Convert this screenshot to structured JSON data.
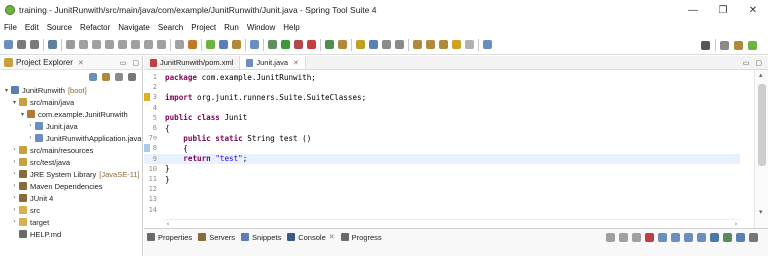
{
  "window": {
    "title": "training - JunitRunwith/src/main/java/com/example/JunitRunwith/Junit.java - Spring Tool Suite 4",
    "controls": [
      {
        "name": "minimize-button",
        "glyph": "—"
      },
      {
        "name": "maximize-button",
        "glyph": "❐"
      },
      {
        "name": "close-button",
        "glyph": "✕"
      }
    ]
  },
  "menu": [
    "File",
    "Edit",
    "Source",
    "Refactor",
    "Navigate",
    "Search",
    "Project",
    "Run",
    "Window",
    "Help"
  ],
  "toolbar": {
    "icons": [
      {
        "name": "new-icon",
        "color": "#6a8fbf"
      },
      {
        "name": "save-icon",
        "color": "#7a7a7a"
      },
      {
        "name": "save-all-icon",
        "color": "#7a7a7a"
      },
      {
        "name": "sep"
      },
      {
        "name": "console-icon",
        "color": "#5f7f9f"
      },
      {
        "name": "sep"
      },
      {
        "name": "skip-breakpoints-icon",
        "color": "#9a9a9a"
      },
      {
        "name": "resume-icon",
        "color": "#a0a0a0"
      },
      {
        "name": "suspend-icon",
        "color": "#a0a0a0"
      },
      {
        "name": "terminate-icon",
        "color": "#a0a0a0"
      },
      {
        "name": "disconnect-icon",
        "color": "#a0a0a0"
      },
      {
        "name": "step-into-icon",
        "color": "#a0a0a0"
      },
      {
        "name": "step-over-icon",
        "color": "#a0a0a0"
      },
      {
        "name": "step-return-icon",
        "color": "#a0a0a0"
      },
      {
        "name": "sep"
      },
      {
        "name": "use-step-filters-icon",
        "color": "#a0a0a0"
      },
      {
        "name": "boot-dashboard-icon",
        "color": "#c07a2a"
      },
      {
        "name": "sep"
      },
      {
        "name": "spring-starter-icon",
        "color": "#6db33f"
      },
      {
        "name": "new-java-project-icon",
        "color": "#5a7fb0"
      },
      {
        "name": "new-package-icon",
        "color": "#b08a3a"
      },
      {
        "name": "sep"
      },
      {
        "name": "open-type-icon",
        "color": "#6a8fbf"
      },
      {
        "name": "sep"
      },
      {
        "name": "debug-icon",
        "color": "#5f8f5f"
      },
      {
        "name": "run-icon",
        "color": "#3a9a3a"
      },
      {
        "name": "coverage-icon",
        "color": "#b04a4a"
      },
      {
        "name": "external-tools-icon",
        "color": "#c04040"
      },
      {
        "name": "sep"
      },
      {
        "name": "new-class-icon",
        "color": "#4f8f4f"
      },
      {
        "name": "pencil-icon",
        "color": "#b08a3a"
      },
      {
        "name": "sep"
      },
      {
        "name": "toggle-mark-occurrences-icon",
        "color": "#c0a020"
      },
      {
        "name": "pin-icon",
        "color": "#5a7fb0"
      },
      {
        "name": "show-whitespace-icon",
        "color": "#8a8a8a"
      },
      {
        "name": "block-selection-icon",
        "color": "#8a8a8a"
      },
      {
        "name": "sep"
      },
      {
        "name": "next-annotation-icon",
        "color": "#b08a3a"
      },
      {
        "name": "previous-annotation-icon",
        "color": "#b08a3a"
      },
      {
        "name": "last-edit-icon",
        "color": "#b08a3a"
      },
      {
        "name": "back-icon",
        "color": "#d0a020"
      },
      {
        "name": "forward-icon",
        "color": "#b0b0b0"
      },
      {
        "name": "sep"
      },
      {
        "name": "open-perspective-icon",
        "color": "#6a8fbf"
      }
    ],
    "right_icons": [
      {
        "name": "search-icon",
        "color": "#555555"
      },
      {
        "name": "sep"
      },
      {
        "name": "java-ee-perspective-icon",
        "color": "#8a8a8a"
      },
      {
        "name": "java-perspective-icon",
        "color": "#b08a3a"
      },
      {
        "name": "spring-perspective-icon",
        "color": "#6db33f"
      }
    ]
  },
  "explorer": {
    "title": "Project Explorer",
    "tools": [
      {
        "name": "collapse-all-icon",
        "color": "#6a8fbf"
      },
      {
        "name": "link-with-editor-icon",
        "color": "#b08a3a"
      },
      {
        "name": "filter-icon",
        "color": "#8a8a8a"
      },
      {
        "name": "view-menu-icon",
        "color": "#777777"
      }
    ],
    "tree": [
      {
        "indent": 0,
        "arrow": "▾",
        "icon": "project-icon",
        "color": "#5a7fb0",
        "label": "JunitRunwith",
        "deco": "[boot]"
      },
      {
        "indent": 1,
        "arrow": "▾",
        "icon": "source-folder-icon",
        "color": "#c8a040",
        "label": "src/main/java",
        "deco": ""
      },
      {
        "indent": 2,
        "arrow": "▾",
        "icon": "package-icon",
        "color": "#b07a30",
        "label": "com.example.JunitRunwith",
        "deco": ""
      },
      {
        "indent": 3,
        "arrow": "›",
        "icon": "java-file-icon",
        "color": "#6a8fbf",
        "label": "Junit.java",
        "deco": ""
      },
      {
        "indent": 3,
        "arrow": "›",
        "icon": "java-file-icon",
        "color": "#6a8fbf",
        "label": "JunitRunwithApplication.java",
        "deco": ""
      },
      {
        "indent": 1,
        "arrow": "›",
        "icon": "source-folder-icon",
        "color": "#c8a040",
        "label": "src/main/resources",
        "deco": ""
      },
      {
        "indent": 1,
        "arrow": "›",
        "icon": "source-folder-icon",
        "color": "#c8a040",
        "label": "src/test/java",
        "deco": ""
      },
      {
        "indent": 1,
        "arrow": "›",
        "icon": "library-icon",
        "color": "#8a6a3a",
        "label": "JRE System Library",
        "deco": "[JavaSE-11]"
      },
      {
        "indent": 1,
        "arrow": "›",
        "icon": "library-icon",
        "color": "#8a6a3a",
        "label": "Maven Dependencies",
        "deco": ""
      },
      {
        "indent": 1,
        "arrow": "›",
        "icon": "library-icon",
        "color": "#8a6a3a",
        "label": "JUnit 4",
        "deco": ""
      },
      {
        "indent": 1,
        "arrow": "›",
        "icon": "folder-icon",
        "color": "#d8b050",
        "label": "src",
        "deco": ""
      },
      {
        "indent": 1,
        "arrow": "›",
        "icon": "folder-icon",
        "color": "#d8b050",
        "label": "target",
        "deco": ""
      },
      {
        "indent": 1,
        "arrow": "",
        "icon": "markdown-file-icon",
        "color": "#6a6a6a",
        "label": "HELP.md",
        "deco": ""
      }
    ]
  },
  "editor": {
    "tabs": [
      {
        "label": "JunitRunwith/pom.xml",
        "color": "#c04040",
        "active": false
      },
      {
        "label": "Junit.java",
        "color": "#6a8fbf",
        "active": true
      }
    ],
    "lines": [
      {
        "n": "1",
        "tokens": [
          [
            "kw",
            "package"
          ],
          [
            "",
            " com.example.JunitRunwith;"
          ]
        ]
      },
      {
        "n": "2",
        "tokens": []
      },
      {
        "n": "3",
        "tokens": [
          [
            "kw",
            "import"
          ],
          [
            "",
            " org.junit.runners.Suite.SuiteClasses;"
          ]
        ],
        "marker": "#e0b020"
      },
      {
        "n": "4",
        "tokens": []
      },
      {
        "n": "5",
        "tokens": [
          [
            "kw",
            "public class"
          ],
          [
            "",
            " Junit"
          ]
        ]
      },
      {
        "n": "6",
        "tokens": [
          [
            "",
            "{"
          ]
        ]
      },
      {
        "n": "7⊖",
        "tokens": [
          [
            "",
            "    "
          ],
          [
            "kw",
            "public static"
          ],
          [
            "",
            " String test ()"
          ]
        ]
      },
      {
        "n": "8",
        "tokens": [
          [
            "",
            "    {"
          ]
        ],
        "marker": "#aac8ea"
      },
      {
        "n": "9",
        "tokens": [
          [
            "",
            "    "
          ],
          [
            "kw",
            "return"
          ],
          [
            "",
            " "
          ],
          [
            "str",
            "\"test\""
          ],
          [
            "",
            ";"
          ]
        ],
        "highlight": true
      },
      {
        "n": "10",
        "tokens": [
          [
            "",
            "}"
          ]
        ]
      },
      {
        "n": "11",
        "tokens": [
          [
            "",
            "}"
          ]
        ]
      },
      {
        "n": "12",
        "tokens": []
      },
      {
        "n": "13",
        "tokens": []
      },
      {
        "n": "14",
        "tokens": []
      }
    ]
  },
  "bottom": {
    "tabs": [
      {
        "label": "Properties",
        "icon": "properties-icon",
        "color": "#6a6a6a",
        "close": false
      },
      {
        "label": "Servers",
        "icon": "servers-icon",
        "color": "#8a6a3a",
        "close": false
      },
      {
        "label": "Snippets",
        "icon": "snippets-icon",
        "color": "#5a7fb0",
        "close": false
      },
      {
        "label": "Console",
        "icon": "console-icon",
        "color": "#3a5a8a",
        "close": true
      },
      {
        "label": "Progress",
        "icon": "progress-icon",
        "color": "#6a6a6a",
        "close": false
      }
    ],
    "tools": [
      {
        "name": "clear-console-icon",
        "color": "#a0a0a0"
      },
      {
        "name": "remove-launch-icon",
        "color": "#a0a0a0"
      },
      {
        "name": "remove-all-icon",
        "color": "#a0a0a0"
      },
      {
        "name": "terminate-icon",
        "color": "#c04040"
      },
      {
        "name": "scroll-lock-icon",
        "color": "#6a8fbf"
      },
      {
        "name": "word-wrap-icon",
        "color": "#6a8fbf"
      },
      {
        "name": "show-on-output-icon",
        "color": "#6a8fbf"
      },
      {
        "name": "pin-console-icon",
        "color": "#6a8fbf"
      },
      {
        "name": "display-console-icon",
        "color": "#4a7aa0"
      },
      {
        "name": "open-console-icon",
        "color": "#5a8a5a"
      },
      {
        "name": "new-console-icon",
        "color": "#5a7fb0"
      },
      {
        "name": "view-menu-icon",
        "color": "#777777"
      }
    ]
  }
}
